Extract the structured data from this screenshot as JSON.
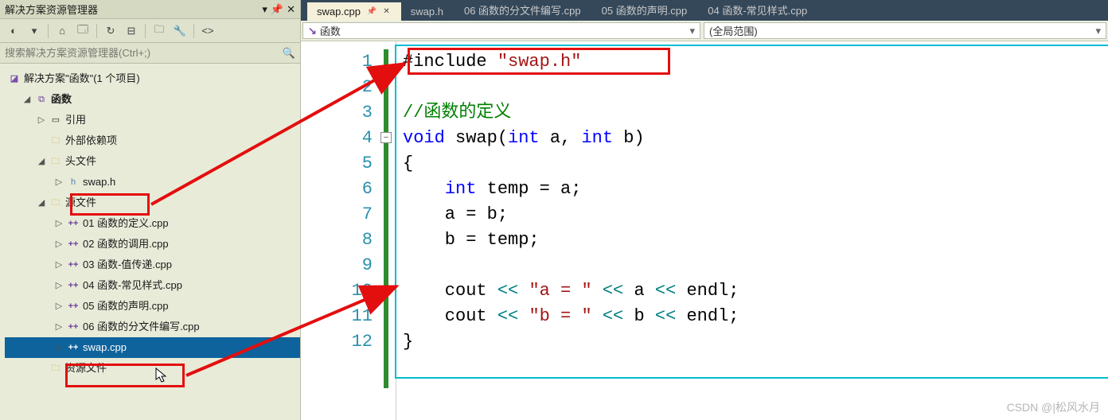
{
  "panel": {
    "title": "解决方案资源管理器",
    "search_placeholder": "搜索解决方案资源管理器(Ctrl+;)"
  },
  "solution": {
    "label": "解决方案\"函数\"(1 个项目)",
    "project": "函数",
    "refs": "引用",
    "external": "外部依赖项",
    "headers_folder": "头文件",
    "sources_folder": "源文件",
    "resources_folder": "资源文件",
    "header_file": "swap.h",
    "sources": [
      "01 函数的定义.cpp",
      "02 函数的调用.cpp",
      "03 函数-值传递.cpp",
      "04 函数-常见样式.cpp",
      "05 函数的声明.cpp",
      "06 函数的分文件编写.cpp",
      "swap.cpp"
    ]
  },
  "editor_tabs": [
    {
      "label": "swap.cpp",
      "active": true,
      "pinned": true
    },
    {
      "label": "swap.h"
    },
    {
      "label": "06 函数的分文件编写.cpp"
    },
    {
      "label": "05 函数的声明.cpp"
    },
    {
      "label": "04 函数-常见样式.cpp"
    }
  ],
  "combos": {
    "left_icon": "↘",
    "left": "函数",
    "right": "(全局范围)",
    "far_right": ""
  },
  "code": {
    "lines": [
      "1",
      "2",
      "3",
      "4",
      "5",
      "6",
      "7",
      "8",
      "9",
      "10",
      "11",
      "12"
    ],
    "l1_pre": "#include ",
    "l1_str": "\"swap.h\"",
    "l3": "//函数的定义",
    "l4_a": "void",
    "l4_b": " swap(",
    "l4_c": "int",
    "l4_d": " a, ",
    "l4_e": "int",
    "l4_f": " b)",
    "l5": "{",
    "l6_a": "    ",
    "l6_b": "int",
    "l6_c": " temp = a;",
    "l7": "    a = b;",
    "l8": "    b = temp;",
    "l10_a": "    cout ",
    "l10_op": "<<",
    "l10_sp": " ",
    "l10_str": "\"a = \"",
    "l10_b": " a ",
    "l10_c": " endl;",
    "l11_a": "    cout ",
    "l11_str": "\"b = \"",
    "l11_b": " b ",
    "l11_c": " endl;",
    "l12": "}"
  },
  "watermark": "CSDN @|松风水月"
}
